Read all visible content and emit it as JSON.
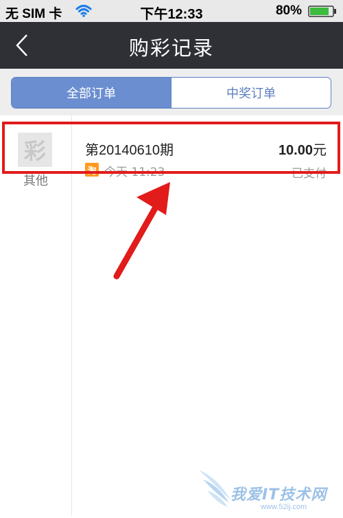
{
  "status_bar": {
    "carrier": "无 SIM 卡",
    "time": "下午12:33",
    "battery": "80%"
  },
  "nav": {
    "title": "购彩记录",
    "back_icon": "chevron-left-icon"
  },
  "tabs": [
    {
      "label": "全部订单",
      "active": true
    },
    {
      "label": "中奖订单",
      "active": false
    }
  ],
  "orders": [
    {
      "icon_char": "彩",
      "type": "其他",
      "issue": "第20140610期",
      "source_badge": "淘",
      "time": "今天 11:23",
      "amount": "10.00",
      "currency": "元",
      "status": "已支付"
    }
  ],
  "watermark": {
    "title": "我爱IT技术网",
    "url": "www.52ij.com"
  },
  "colors": {
    "nav_bg": "#2e3035",
    "accent": "#6b8ed0",
    "highlight": "#e21b1b",
    "badge": "#ff9a1f"
  }
}
